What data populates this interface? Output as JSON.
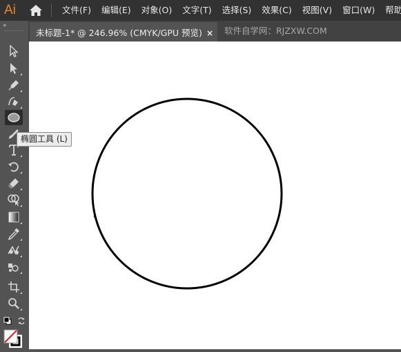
{
  "app": {
    "logo_text": "Ai",
    "brand_color": "#e6892d"
  },
  "menu": {
    "items": [
      {
        "label": "文件(F)"
      },
      {
        "label": "编辑(E)"
      },
      {
        "label": "对象(O)"
      },
      {
        "label": "文字(T)"
      },
      {
        "label": "选择(S)"
      },
      {
        "label": "效果(C)"
      },
      {
        "label": "视图(V)"
      },
      {
        "label": "窗口(W)"
      },
      {
        "label": "帮助(H)"
      }
    ]
  },
  "tabs": {
    "active": {
      "title": "未标题-1* @ 246.96% (CMYK/GPU 预览)",
      "close": "×"
    },
    "inactive": {
      "title": "软件自学网：RJZXW.COM"
    }
  },
  "toolbar": {
    "collapse_glyph": "»",
    "tools": [
      {
        "name": "selection-tool",
        "icon": "arrow-icon"
      },
      {
        "name": "direct-selection-tool",
        "icon": "white-arrow-icon"
      },
      {
        "name": "pen-tool",
        "icon": "pen-icon"
      },
      {
        "name": "curvature-tool",
        "icon": "curvature-icon"
      },
      {
        "name": "ellipse-tool",
        "icon": "ellipse-icon",
        "active": true
      },
      {
        "name": "paintbrush-tool",
        "icon": "brush-icon"
      },
      {
        "name": "type-tool",
        "icon": "type-icon"
      },
      {
        "name": "rotate-tool",
        "icon": "rotate-icon"
      },
      {
        "name": "eraser-tool",
        "icon": "eraser-icon"
      },
      {
        "name": "shape-builder-tool",
        "icon": "shape-builder-icon"
      },
      {
        "name": "gradient-tool",
        "icon": "gradient-icon"
      },
      {
        "name": "eyedropper-tool",
        "icon": "eyedropper-icon"
      },
      {
        "name": "blend-tool",
        "icon": "blend-icon"
      },
      {
        "name": "symbol-sprayer-tool",
        "icon": "symbol-icon"
      },
      {
        "name": "artboard-tool",
        "icon": "artboard-icon"
      },
      {
        "name": "zoom-tool",
        "icon": "zoom-icon"
      }
    ]
  },
  "tooltip": {
    "text": "椭圆工具 (L)"
  },
  "colors": {
    "fill": "none",
    "stroke": "#000000"
  }
}
